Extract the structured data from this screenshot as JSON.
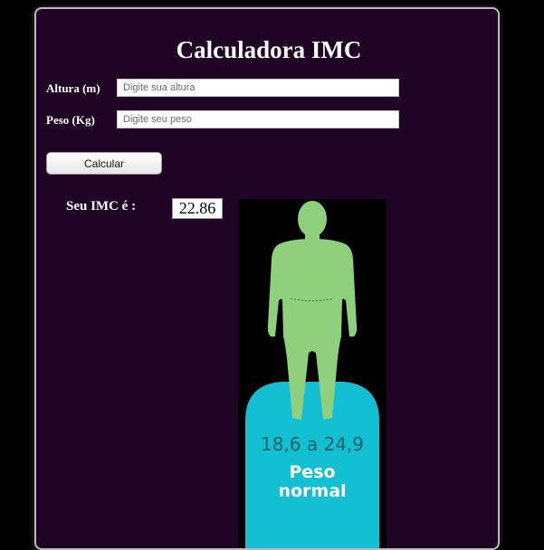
{
  "page": {
    "title": "Calculadora IMC"
  },
  "form": {
    "altura_label": "Altura (m)",
    "altura_placeholder": "Digite sua altura",
    "altura_value": "",
    "peso_label": "Peso (Kg)",
    "peso_placeholder": "Digite seu peso",
    "peso_value": "",
    "calc_button": "Calcular"
  },
  "result": {
    "label": "Seu IMC é :",
    "value": "22.86"
  },
  "figure": {
    "icon": "human-body-icon",
    "range": "18,6 a 24,9",
    "category": "Peso normal",
    "colors": {
      "body": "#8ed07b",
      "pedestal": "#12bfd3",
      "range_text": "#0c5f6b"
    }
  },
  "colors": {
    "page_bg": "#000000",
    "panel_bg": "#1f0426"
  }
}
